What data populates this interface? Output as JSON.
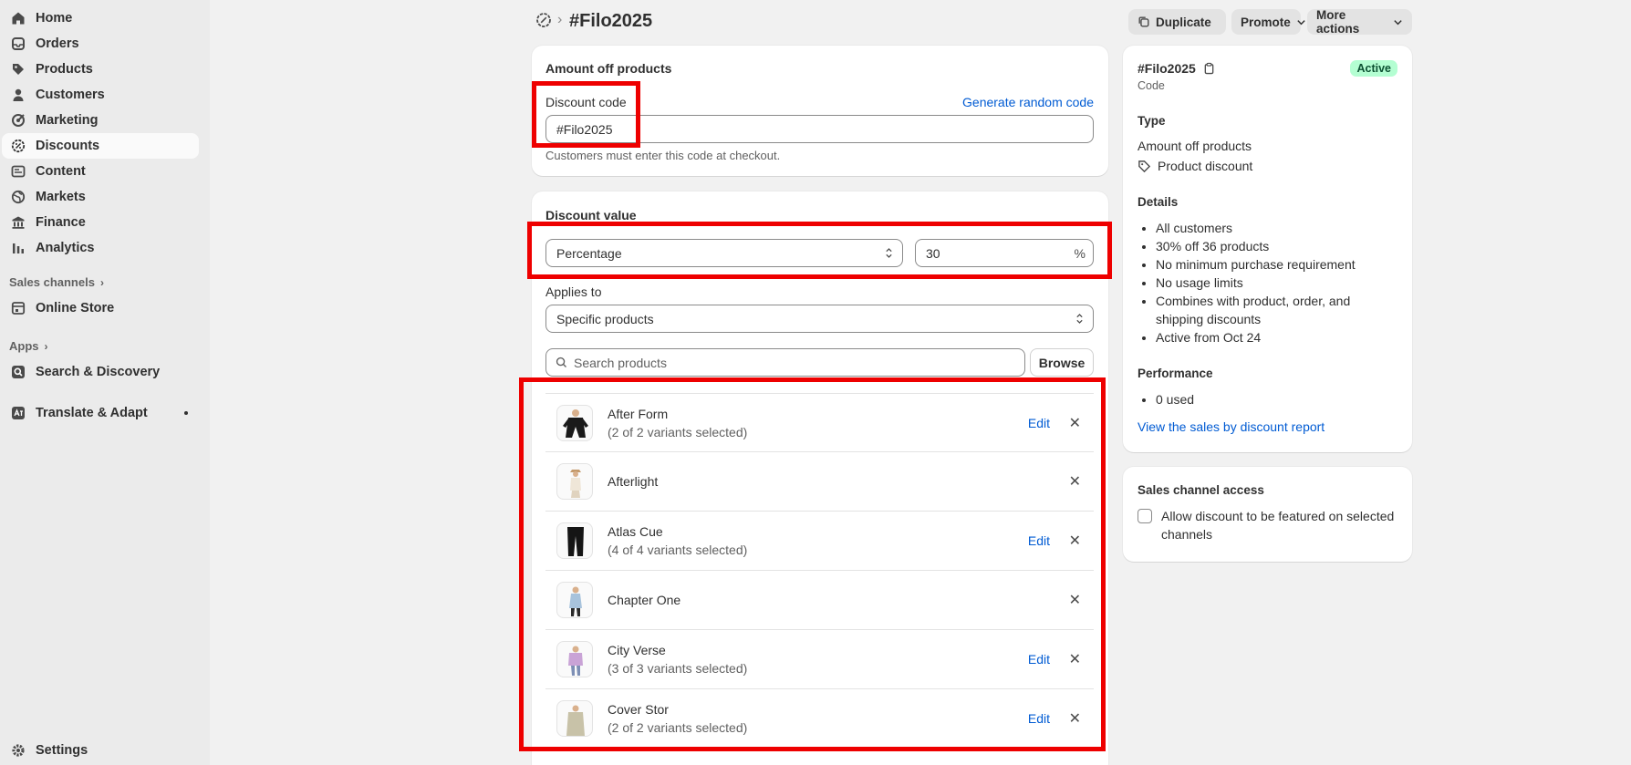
{
  "sidebar": {
    "items": [
      {
        "label": "Home",
        "icon": "home-icon"
      },
      {
        "label": "Orders",
        "icon": "orders-icon"
      },
      {
        "label": "Products",
        "icon": "tag-icon"
      },
      {
        "label": "Customers",
        "icon": "person-icon"
      },
      {
        "label": "Marketing",
        "icon": "target-icon"
      },
      {
        "label": "Discounts",
        "icon": "discount-icon"
      },
      {
        "label": "Content",
        "icon": "content-icon"
      },
      {
        "label": "Markets",
        "icon": "globe-icon"
      },
      {
        "label": "Finance",
        "icon": "bank-icon"
      },
      {
        "label": "Analytics",
        "icon": "bar-chart-icon"
      }
    ],
    "sales_channels_label": "Sales channels",
    "online_store": "Online Store",
    "apps_label": "Apps",
    "search_discovery": "Search & Discovery",
    "translate_adapt": "Translate & Adapt",
    "settings": "Settings"
  },
  "header": {
    "title": "#Filo2025",
    "duplicate": "Duplicate",
    "promote": "Promote",
    "more_actions": "More actions"
  },
  "code_card": {
    "title": "Amount off products",
    "field_label": "Discount code",
    "generate_link": "Generate random code",
    "value": "#Filo2025",
    "help": "Customers must enter this code at checkout."
  },
  "value_card": {
    "title": "Discount value",
    "type_value": "Percentage",
    "amount": "30",
    "suffix": "%",
    "applies_label": "Applies to",
    "applies_value": "Specific products",
    "search_placeholder": "Search products",
    "browse": "Browse",
    "edit_label": "Edit",
    "products": [
      {
        "name": "After Form",
        "variants": "(2 of 2 variants selected)"
      },
      {
        "name": "Afterlight",
        "variants": ""
      },
      {
        "name": "Atlas Cue",
        "variants": "(4 of 4 variants selected)"
      },
      {
        "name": "Chapter One",
        "variants": ""
      },
      {
        "name": "City Verse",
        "variants": "(3 of 3 variants selected)"
      },
      {
        "name": "Cover Stor",
        "variants": "(2 of 2 variants selected)"
      }
    ]
  },
  "summary": {
    "code": "#Filo2025",
    "code_caption": "Code",
    "status": "Active",
    "type_heading": "Type",
    "type_value": "Amount off products",
    "type_kind": "Product discount",
    "details_heading": "Details",
    "details": [
      "All customers",
      "30% off 36 products",
      "No minimum purchase requirement",
      "No usage limits",
      "Combines with product, order, and shipping discounts",
      "Active from Oct 24"
    ],
    "performance_heading": "Performance",
    "performance": [
      "0 used"
    ],
    "report_link": "View the sales by discount report"
  },
  "channel": {
    "heading": "Sales channel access",
    "checkbox_label": "Allow discount to be featured on selected channels"
  },
  "colors": {
    "accent": "#005bd3",
    "highlight": "#ee0000",
    "active_badge": "#b4fed2"
  }
}
